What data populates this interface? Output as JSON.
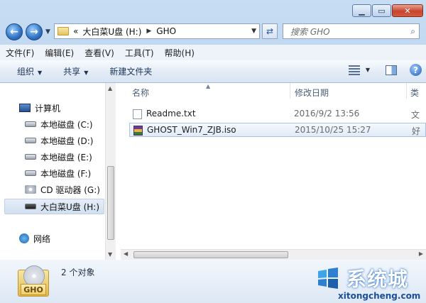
{
  "window": {
    "caption_buttons": [
      "minimize",
      "maximize",
      "close"
    ]
  },
  "navigation": {
    "address_segments": [
      "«",
      "大白菜U盘 (H:)",
      "GHO"
    ],
    "search_placeholder": "搜索 GHO"
  },
  "menubar": {
    "items": [
      "文件(F)",
      "编辑(E)",
      "查看(V)",
      "工具(T)",
      "帮助(H)"
    ]
  },
  "toolbar": {
    "organize_label": "组织",
    "share_label": "共享",
    "new_folder_label": "新建文件夹"
  },
  "nav_pane": {
    "computer_label": "计算机",
    "drives": [
      {
        "label": "本地磁盘 (C:)",
        "icon": "system-drive-icon"
      },
      {
        "label": "本地磁盘 (D:)",
        "icon": "hard-drive-icon"
      },
      {
        "label": "本地磁盘 (E:)",
        "icon": "hard-drive-icon"
      },
      {
        "label": "本地磁盘 (F:)",
        "icon": "hard-drive-icon"
      },
      {
        "label": "CD 驱动器 (G:)",
        "icon": "cd-drive-icon"
      },
      {
        "label": "大白菜U盘 (H:)",
        "icon": "usb-drive-icon",
        "selected": true
      }
    ],
    "network_label": "网络"
  },
  "file_list": {
    "columns": {
      "name": "名称",
      "date": "修改日期",
      "type": "类"
    },
    "rows": [
      {
        "name": "Readme.txt",
        "date": "2016/9/2 13:56",
        "type": "文",
        "icon": "text-file-icon",
        "selected": false
      },
      {
        "name": "GHOST_Win7_ZJB.iso",
        "date": "2015/10/25 15:27",
        "type": "好",
        "icon": "archive-file-icon",
        "selected": true
      }
    ]
  },
  "details": {
    "icon_label": "GHO",
    "object_count": "2 个对象"
  },
  "watermark": {
    "text": "系统城",
    "url": "xitongcheng.com"
  },
  "colors": {
    "frame": "#b7d1ee",
    "selection_border": "#a7c3e6",
    "accent_blue": "#2e73c3"
  }
}
